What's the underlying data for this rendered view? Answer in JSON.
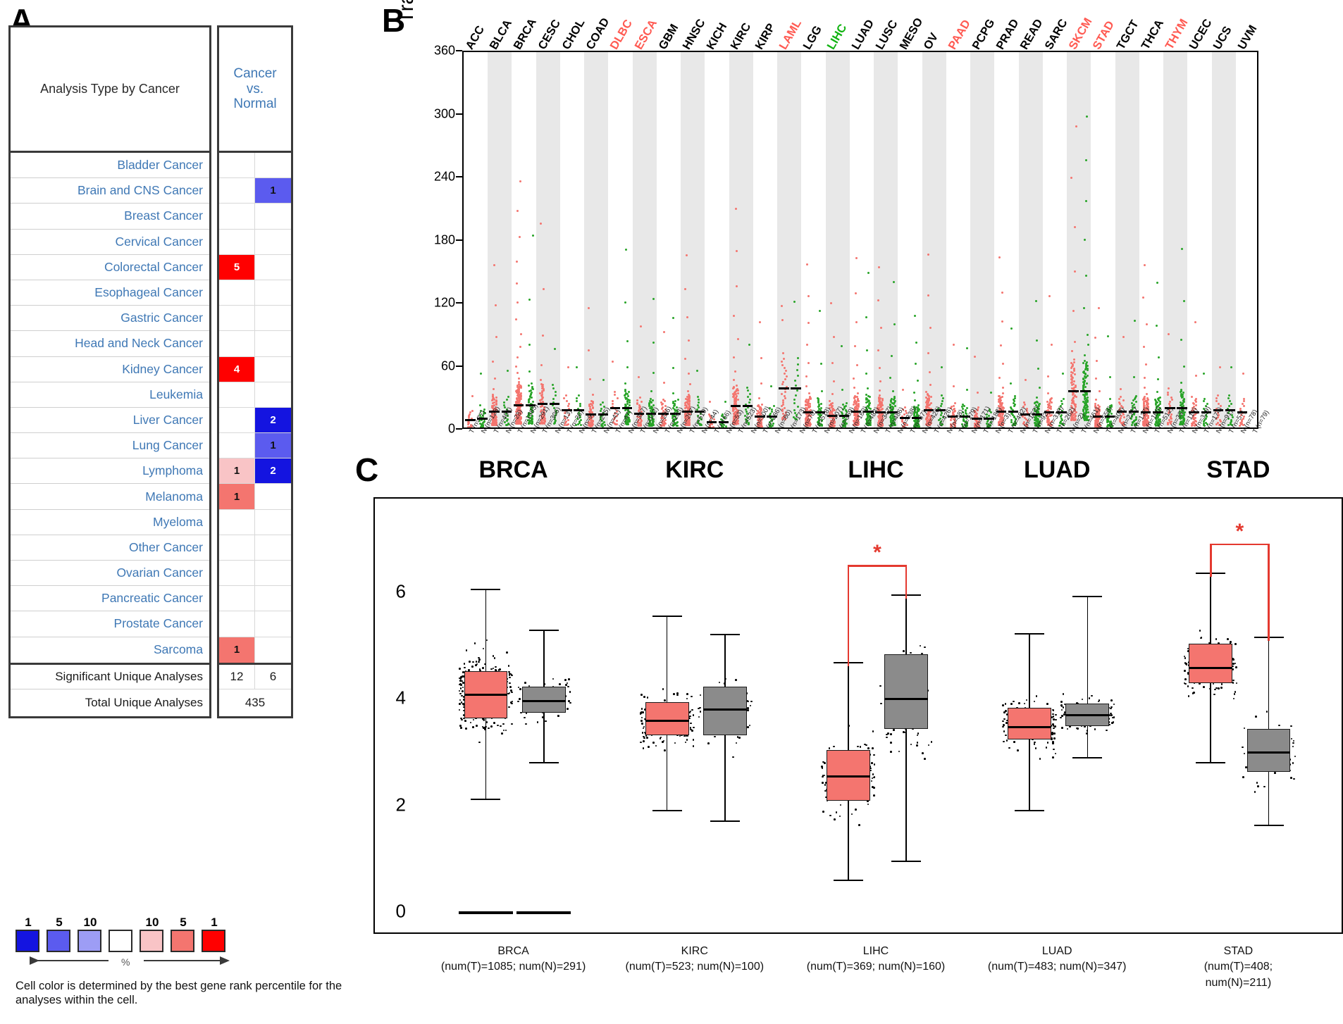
{
  "panels": {
    "a_letter": "A",
    "b_letter": "B",
    "c_letter": "C"
  },
  "panelA": {
    "header_left": "Analysis Type by Cancer",
    "header_right": "Cancer\nvs.\nNormal",
    "header_right_lines": [
      "Cancer",
      "vs.",
      "Normal"
    ],
    "rows": [
      {
        "label": "Bladder Cancer",
        "over": "",
        "under": ""
      },
      {
        "label": "Brain and CNS Cancer",
        "over": "",
        "under": "1"
      },
      {
        "label": "Breast Cancer",
        "over": "",
        "under": ""
      },
      {
        "label": "Cervical Cancer",
        "over": "",
        "under": ""
      },
      {
        "label": "Colorectal Cancer",
        "over": "5",
        "under": ""
      },
      {
        "label": "Esophageal Cancer",
        "over": "",
        "under": ""
      },
      {
        "label": "Gastric Cancer",
        "over": "",
        "under": ""
      },
      {
        "label": "Head and Neck Cancer",
        "over": "",
        "under": ""
      },
      {
        "label": "Kidney Cancer",
        "over": "4",
        "under": ""
      },
      {
        "label": "Leukemia",
        "over": "",
        "under": ""
      },
      {
        "label": "Liver Cancer",
        "over": "",
        "under": "2"
      },
      {
        "label": "Lung Cancer",
        "over": "",
        "under": "1"
      },
      {
        "label": "Lymphoma",
        "over": "1",
        "under": "2"
      },
      {
        "label": "Melanoma",
        "over": "1",
        "under": ""
      },
      {
        "label": "Myeloma",
        "over": "",
        "under": ""
      },
      {
        "label": "Other Cancer",
        "over": "",
        "under": ""
      },
      {
        "label": "Ovarian Cancer",
        "over": "",
        "under": ""
      },
      {
        "label": "Pancreatic Cancer",
        "over": "",
        "under": ""
      },
      {
        "label": "Prostate Cancer",
        "over": "",
        "under": ""
      },
      {
        "label": "Sarcoma",
        "over": "1",
        "under": ""
      }
    ],
    "cell_colors": {
      "5": "#ff0000",
      "4": "#ff0000",
      "1_light": "#f9c4c6",
      "1_mid": "#f4756f",
      "blue_2": "#1414e0",
      "blue_1": "#5b5bef"
    },
    "footer": {
      "significant_label": "Significant Unique Analyses",
      "significant_over": "12",
      "significant_under": "6",
      "total_label": "Total Unique Analyses",
      "total_value": "435"
    },
    "legend": {
      "numbers": [
        "1",
        "5",
        "10",
        "",
        "10",
        "5",
        "1"
      ],
      "colors": [
        "#1414e0",
        "#5b5bef",
        "#9d9df5",
        "#ffffff",
        "#f9c4c6",
        "#f4756f",
        "#ff0000"
      ],
      "pct_symbol": "%",
      "note": "Cell color is determined by the best gene rank percentile for the analyses within the cell."
    }
  },
  "panelB": {
    "ylabel": "Transcripts Per Million (TPM)",
    "yticks": [
      "360",
      "300",
      "240",
      "180",
      "120",
      "60",
      "0"
    ],
    "ytick_values": [
      360,
      300,
      240,
      180,
      120,
      60,
      0
    ],
    "ylim": [
      0,
      360
    ],
    "cohorts": [
      {
        "code": "ACC",
        "color": "black",
        "t": 77,
        "n": 128,
        "t_med": 11,
        "n_med": 12
      },
      {
        "code": "BLCA",
        "color": "black",
        "t": 404,
        "n": 28,
        "t_med": 19,
        "n_med": 19
      },
      {
        "code": "BRCA",
        "color": "black",
        "t": 1085,
        "n": 291,
        "t_med": 25,
        "n_med": 25
      },
      {
        "code": "CESC",
        "color": "black",
        "t": 306,
        "n": 13,
        "t_med": 26,
        "n_med": 26
      },
      {
        "code": "CHOL",
        "color": "black",
        "t": 36,
        "n": 9,
        "t_med": 20,
        "n_med": 20
      },
      {
        "code": "COAD",
        "color": "black",
        "t": 275,
        "n": 41,
        "t_med": 16,
        "n_med": 16
      },
      {
        "code": "DLBC",
        "color": "red",
        "t": 47,
        "n": 337,
        "t_med": 22,
        "n_med": 22
      },
      {
        "code": "ESCA",
        "color": "red",
        "t": 182,
        "n": 286,
        "t_med": 17,
        "n_med": 17
      },
      {
        "code": "GBM",
        "color": "black",
        "t": 163,
        "n": 207,
        "t_med": 17,
        "n_med": 17
      },
      {
        "code": "HNSC",
        "color": "black",
        "t": 519,
        "n": 44,
        "t_med": 19,
        "n_med": 19
      },
      {
        "code": "KICH",
        "color": "black",
        "t": 66,
        "n": 53,
        "t_med": 9,
        "n_med": 9
      },
      {
        "code": "KIRC",
        "color": "black",
        "t": 523,
        "n": 100,
        "t_med": 24,
        "n_med": 24
      },
      {
        "code": "KIRP",
        "color": "black",
        "t": 286,
        "n": 60,
        "t_med": 14,
        "n_med": 14
      },
      {
        "code": "LAML",
        "color": "red",
        "t": 173,
        "n": 70,
        "t_med": 41,
        "n_med": 41
      },
      {
        "code": "LGG",
        "color": "black",
        "t": 518,
        "n": 207,
        "t_med": 18,
        "n_med": 18
      },
      {
        "code": "LIHC",
        "color": "green",
        "t": 369,
        "n": 160,
        "t_med": 15,
        "n_med": 15
      },
      {
        "code": "LUAD",
        "color": "black",
        "t": 483,
        "n": 347,
        "t_med": 19,
        "n_med": 19
      },
      {
        "code": "LUSC",
        "color": "black",
        "t": 486,
        "n": 338,
        "t_med": 18,
        "n_med": 18
      },
      {
        "code": "MESO",
        "color": "black",
        "t": 87,
        "n": 426,
        "t_med": 13,
        "n_med": 13
      },
      {
        "code": "OV",
        "color": "black",
        "t": 426,
        "n": 88,
        "t_med": 20,
        "n_med": 20
      },
      {
        "code": "PAAD",
        "color": "red",
        "t": 179,
        "n": 171,
        "t_med": 14,
        "n_med": 14
      },
      {
        "code": "PCPG",
        "color": "black",
        "t": 182,
        "n": 3,
        "t_med": 12,
        "n_med": 12
      },
      {
        "code": "PRAD",
        "color": "black",
        "t": 492,
        "n": 152,
        "t_med": 19,
        "n_med": 19
      },
      {
        "code": "READ",
        "color": "black",
        "t": 92,
        "n": 318,
        "t_med": 16,
        "n_med": 16
      },
      {
        "code": "SARC",
        "color": "black",
        "t": 262,
        "n": 2,
        "t_med": 18,
        "n_med": 18
      },
      {
        "code": "SKCM",
        "color": "red",
        "t": 461,
        "n": 558,
        "t_med": 38,
        "n_med": 38
      },
      {
        "code": "STAD",
        "color": "red",
        "t": 408,
        "n": 211,
        "t_med": 14,
        "n_med": 14
      },
      {
        "code": "TGCT",
        "color": "black",
        "t": 137,
        "n": 165,
        "t_med": 19,
        "n_med": 19
      },
      {
        "code": "THCA",
        "color": "black",
        "t": 512,
        "n": 337,
        "t_med": 18,
        "n_med": 18
      },
      {
        "code": "THYM",
        "color": "red",
        "t": 118,
        "n": 339,
        "t_med": 22,
        "n_med": 22
      },
      {
        "code": "UCEC",
        "color": "black",
        "t": 174,
        "n": 91,
        "t_med": 18,
        "n_med": 18
      },
      {
        "code": "UCS",
        "color": "black",
        "t": 57,
        "n": 78,
        "t_med": 20,
        "n_med": 20
      },
      {
        "code": "UVM",
        "color": "black",
        "t": 79,
        "n": 0,
        "t_med": 18,
        "n_med": 18
      }
    ],
    "n_labels": [
      "T (n=77)",
      "N (n=128)",
      "T (n=404)",
      "N (n=28)",
      "T (n=1085)",
      "N (n=291)",
      "T (n=306)",
      "N (n=13)",
      "T (n=36)",
      "N (n=9)",
      "T (n=275)",
      "N (n=41)",
      "T (n=47)",
      "N (n=337)",
      "T (n=182)",
      "N (n=286)",
      "T (n=163)",
      "N (n=207)",
      "T (n=519)",
      "N (n=44)",
      "T (n=66)",
      "N (n=53)",
      "T (n=523)",
      "N (n=100)",
      "T (n=286)",
      "N (n=60)",
      "T (n=173)",
      "N (n=70)",
      "T (n=518)",
      "N (n=207)",
      "T (n=369)",
      "N (n=160)",
      "T (n=483)",
      "N (n=347)",
      "T (n=486)",
      "N (n=338)",
      "T (n=87)",
      "N (n=426)",
      "T (n=426)",
      "N (n=88)",
      "T (n=179)",
      "N (n=171)",
      "T (n=182)",
      "N (n=3)",
      "T (n=492)",
      "N (n=152)",
      "T (n=92)",
      "N (n=318)",
      "T (n=262)",
      "N (n=2)",
      "T (n=461)",
      "N (n=558)",
      "T (n=408)",
      "N (n=211)",
      "T (n=137)",
      "N (n=165)",
      "T (n=512)",
      "N (n=337)",
      "T (n=118)",
      "N (n=339)",
      "T (n=174)",
      "N (n=91)",
      "T (n=57)",
      "N (n=78)",
      "T (n=79)"
    ],
    "colors": {
      "tumor_dot": "#f4756f",
      "normal_dot": "#28a428",
      "median": "#000000",
      "stripe": "#e8e8e8",
      "label_red": "#ff5a52",
      "label_green": "#12b312",
      "label_black": "#000000"
    }
  },
  "panelC": {
    "ylim": [
      0,
      7.4
    ],
    "yticks": [
      "0",
      "2",
      "4",
      "6"
    ],
    "ytick_values": [
      0,
      2,
      4,
      6
    ],
    "groups": [
      {
        "title": "BRCA",
        "xlabel_line1": "BRCA",
        "xlabel_line2": "(num(T)=1085; num(N)=291)",
        "significant": false,
        "tumor": {
          "q1": 3.62,
          "med": 4.08,
          "q3": 4.5,
          "lo": 2.12,
          "hi": 6.05,
          "n": 1085
        },
        "normal": {
          "q1": 3.72,
          "med": 3.97,
          "q3": 4.22,
          "lo": 2.8,
          "hi": 5.28,
          "n": 291
        },
        "baseline": true
      },
      {
        "title": "KIRC",
        "xlabel_line1": "KIRC",
        "xlabel_line2": "(num(T)=523; num(N)=100)",
        "significant": false,
        "tumor": {
          "q1": 3.3,
          "med": 3.6,
          "q3": 3.93,
          "lo": 1.9,
          "hi": 5.55,
          "n": 523
        },
        "normal": {
          "q1": 3.3,
          "med": 3.8,
          "q3": 4.22,
          "lo": 1.7,
          "hi": 5.2,
          "n": 100
        },
        "baseline": false
      },
      {
        "title": "LIHC",
        "xlabel_line1": "LIHC",
        "xlabel_line2": "(num(T)=369; num(N)=160)",
        "significant": true,
        "tumor": {
          "q1": 2.08,
          "med": 2.55,
          "q3": 3.02,
          "lo": 0.6,
          "hi": 4.68,
          "n": 369
        },
        "normal": {
          "q1": 3.42,
          "med": 4.0,
          "q3": 4.82,
          "lo": 0.95,
          "hi": 5.95,
          "n": 160
        },
        "baseline": false
      },
      {
        "title": "LUAD",
        "xlabel_line1": "LUAD",
        "xlabel_line2": "(num(T)=483; num(N)=347)",
        "significant": false,
        "tumor": {
          "q1": 3.22,
          "med": 3.48,
          "q3": 3.82,
          "lo": 1.9,
          "hi": 5.22,
          "n": 483
        },
        "normal": {
          "q1": 3.48,
          "med": 3.7,
          "q3": 3.9,
          "lo": 2.9,
          "hi": 5.92,
          "n": 347
        },
        "baseline": false
      },
      {
        "title": "STAD",
        "xlabel_line1": "STAD",
        "xlabel_line2": "(num(T)=408; num(N)=211)",
        "significant": true,
        "tumor": {
          "q1": 4.28,
          "med": 4.58,
          "q3": 5.02,
          "lo": 2.8,
          "hi": 6.35,
          "n": 408
        },
        "normal": {
          "q1": 2.62,
          "med": 3.0,
          "q3": 3.42,
          "lo": 1.62,
          "hi": 5.15,
          "n": 211
        },
        "baseline": false
      }
    ],
    "sig_star": "*",
    "colors": {
      "tumor": "#f4756f",
      "normal": "#8b8b8b",
      "sig": "#e4392f",
      "dot": "#000000"
    }
  }
}
